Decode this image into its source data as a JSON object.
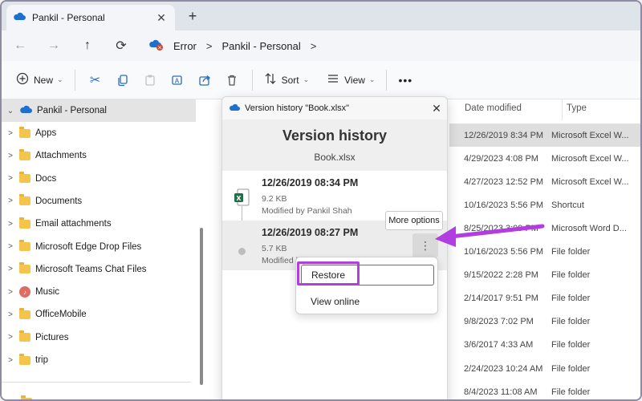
{
  "tab": {
    "title": "Pankil - Personal",
    "close": "✕",
    "new": "+"
  },
  "nav": {
    "back": "←",
    "forward": "→",
    "up": "↑",
    "refresh": "⟳",
    "breadcrumbs": [
      "Error",
      "Pankil - Personal"
    ],
    "sep": ">"
  },
  "toolbar": {
    "new_label": "New",
    "sort_label": "Sort",
    "view_label": "View",
    "more": "•••"
  },
  "sidebar": {
    "root": "Pankil - Personal",
    "items": [
      "Apps",
      "Attachments",
      "Docs",
      "Documents",
      "Email attachments",
      "Microsoft Edge Drop Files",
      "Microsoft Teams Chat Files",
      "Music",
      "OfficeMobile",
      "Pictures",
      "trip"
    ]
  },
  "filelist": {
    "headers": {
      "date": "Date modified",
      "type": "Type"
    },
    "rows": [
      {
        "date": "12/26/2019 8:34 PM",
        "type": "Microsoft Excel W..."
      },
      {
        "date": "4/29/2023 4:08 PM",
        "type": "Microsoft Excel W..."
      },
      {
        "date": "4/27/2023 12:52 PM",
        "type": "Microsoft Excel W..."
      },
      {
        "date": "10/16/2023 5:56 PM",
        "type": "Shortcut"
      },
      {
        "date": "8/25/2023 3:09 PM",
        "type": "Microsoft Word D..."
      },
      {
        "date": "10/16/2023 5:56 PM",
        "type": "File folder"
      },
      {
        "date": "9/15/2022 2:28 PM",
        "type": "File folder"
      },
      {
        "date": "2/14/2017 9:51 PM",
        "type": "File folder"
      },
      {
        "date": "9/8/2023 7:02 PM",
        "type": "File folder"
      },
      {
        "date": "3/6/2017 4:33 AM",
        "type": "File folder"
      },
      {
        "date": "2/24/2023 10:24 AM",
        "type": "File folder"
      },
      {
        "date": "8/4/2023 11:08 AM",
        "type": "File folder"
      }
    ]
  },
  "version_history": {
    "window_title": "Version history \"Book.xlsx\"",
    "heading": "Version history",
    "filename": "Book.xlsx",
    "versions": [
      {
        "date": "12/26/2019 08:34 PM",
        "size": "9.2 KB",
        "modified_by": "Modified by Pankil Shah"
      },
      {
        "date": "12/26/2019 08:27 PM",
        "size": "5.7 KB",
        "modified_by": "Modified by Pankil Shah"
      }
    ],
    "tooltip": "More options",
    "menu": {
      "restore": "Restore",
      "view_online": "View online"
    }
  },
  "colors": {
    "accent": "#2a6dbb",
    "annotation": "#b23de1"
  }
}
